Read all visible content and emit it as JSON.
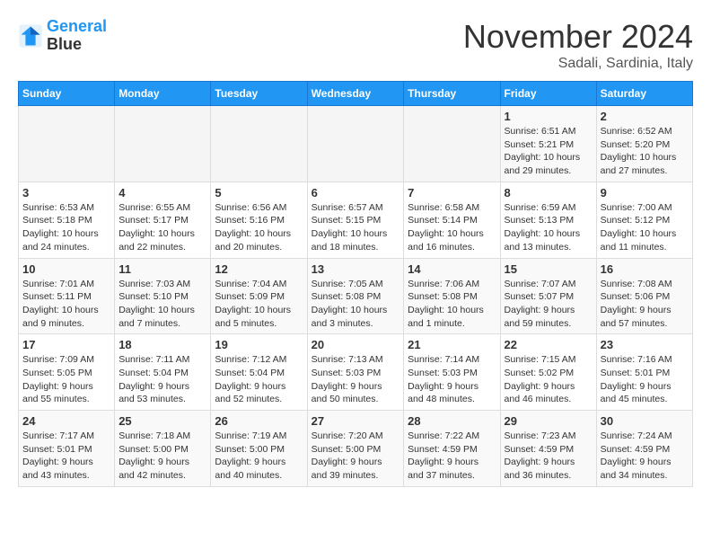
{
  "header": {
    "logo_line1": "General",
    "logo_line2": "Blue",
    "month_title": "November 2024",
    "location": "Sadali, Sardinia, Italy"
  },
  "weekdays": [
    "Sunday",
    "Monday",
    "Tuesday",
    "Wednesday",
    "Thursday",
    "Friday",
    "Saturday"
  ],
  "weeks": [
    [
      {
        "day": "",
        "info": ""
      },
      {
        "day": "",
        "info": ""
      },
      {
        "day": "",
        "info": ""
      },
      {
        "day": "",
        "info": ""
      },
      {
        "day": "",
        "info": ""
      },
      {
        "day": "1",
        "info": "Sunrise: 6:51 AM\nSunset: 5:21 PM\nDaylight: 10 hours and 29 minutes."
      },
      {
        "day": "2",
        "info": "Sunrise: 6:52 AM\nSunset: 5:20 PM\nDaylight: 10 hours and 27 minutes."
      }
    ],
    [
      {
        "day": "3",
        "info": "Sunrise: 6:53 AM\nSunset: 5:18 PM\nDaylight: 10 hours and 24 minutes."
      },
      {
        "day": "4",
        "info": "Sunrise: 6:55 AM\nSunset: 5:17 PM\nDaylight: 10 hours and 22 minutes."
      },
      {
        "day": "5",
        "info": "Sunrise: 6:56 AM\nSunset: 5:16 PM\nDaylight: 10 hours and 20 minutes."
      },
      {
        "day": "6",
        "info": "Sunrise: 6:57 AM\nSunset: 5:15 PM\nDaylight: 10 hours and 18 minutes."
      },
      {
        "day": "7",
        "info": "Sunrise: 6:58 AM\nSunset: 5:14 PM\nDaylight: 10 hours and 16 minutes."
      },
      {
        "day": "8",
        "info": "Sunrise: 6:59 AM\nSunset: 5:13 PM\nDaylight: 10 hours and 13 minutes."
      },
      {
        "day": "9",
        "info": "Sunrise: 7:00 AM\nSunset: 5:12 PM\nDaylight: 10 hours and 11 minutes."
      }
    ],
    [
      {
        "day": "10",
        "info": "Sunrise: 7:01 AM\nSunset: 5:11 PM\nDaylight: 10 hours and 9 minutes."
      },
      {
        "day": "11",
        "info": "Sunrise: 7:03 AM\nSunset: 5:10 PM\nDaylight: 10 hours and 7 minutes."
      },
      {
        "day": "12",
        "info": "Sunrise: 7:04 AM\nSunset: 5:09 PM\nDaylight: 10 hours and 5 minutes."
      },
      {
        "day": "13",
        "info": "Sunrise: 7:05 AM\nSunset: 5:08 PM\nDaylight: 10 hours and 3 minutes."
      },
      {
        "day": "14",
        "info": "Sunrise: 7:06 AM\nSunset: 5:08 PM\nDaylight: 10 hours and 1 minute."
      },
      {
        "day": "15",
        "info": "Sunrise: 7:07 AM\nSunset: 5:07 PM\nDaylight: 9 hours and 59 minutes."
      },
      {
        "day": "16",
        "info": "Sunrise: 7:08 AM\nSunset: 5:06 PM\nDaylight: 9 hours and 57 minutes."
      }
    ],
    [
      {
        "day": "17",
        "info": "Sunrise: 7:09 AM\nSunset: 5:05 PM\nDaylight: 9 hours and 55 minutes."
      },
      {
        "day": "18",
        "info": "Sunrise: 7:11 AM\nSunset: 5:04 PM\nDaylight: 9 hours and 53 minutes."
      },
      {
        "day": "19",
        "info": "Sunrise: 7:12 AM\nSunset: 5:04 PM\nDaylight: 9 hours and 52 minutes."
      },
      {
        "day": "20",
        "info": "Sunrise: 7:13 AM\nSunset: 5:03 PM\nDaylight: 9 hours and 50 minutes."
      },
      {
        "day": "21",
        "info": "Sunrise: 7:14 AM\nSunset: 5:03 PM\nDaylight: 9 hours and 48 minutes."
      },
      {
        "day": "22",
        "info": "Sunrise: 7:15 AM\nSunset: 5:02 PM\nDaylight: 9 hours and 46 minutes."
      },
      {
        "day": "23",
        "info": "Sunrise: 7:16 AM\nSunset: 5:01 PM\nDaylight: 9 hours and 45 minutes."
      }
    ],
    [
      {
        "day": "24",
        "info": "Sunrise: 7:17 AM\nSunset: 5:01 PM\nDaylight: 9 hours and 43 minutes."
      },
      {
        "day": "25",
        "info": "Sunrise: 7:18 AM\nSunset: 5:00 PM\nDaylight: 9 hours and 42 minutes."
      },
      {
        "day": "26",
        "info": "Sunrise: 7:19 AM\nSunset: 5:00 PM\nDaylight: 9 hours and 40 minutes."
      },
      {
        "day": "27",
        "info": "Sunrise: 7:20 AM\nSunset: 5:00 PM\nDaylight: 9 hours and 39 minutes."
      },
      {
        "day": "28",
        "info": "Sunrise: 7:22 AM\nSunset: 4:59 PM\nDaylight: 9 hours and 37 minutes."
      },
      {
        "day": "29",
        "info": "Sunrise: 7:23 AM\nSunset: 4:59 PM\nDaylight: 9 hours and 36 minutes."
      },
      {
        "day": "30",
        "info": "Sunrise: 7:24 AM\nSunset: 4:59 PM\nDaylight: 9 hours and 34 minutes."
      }
    ]
  ]
}
